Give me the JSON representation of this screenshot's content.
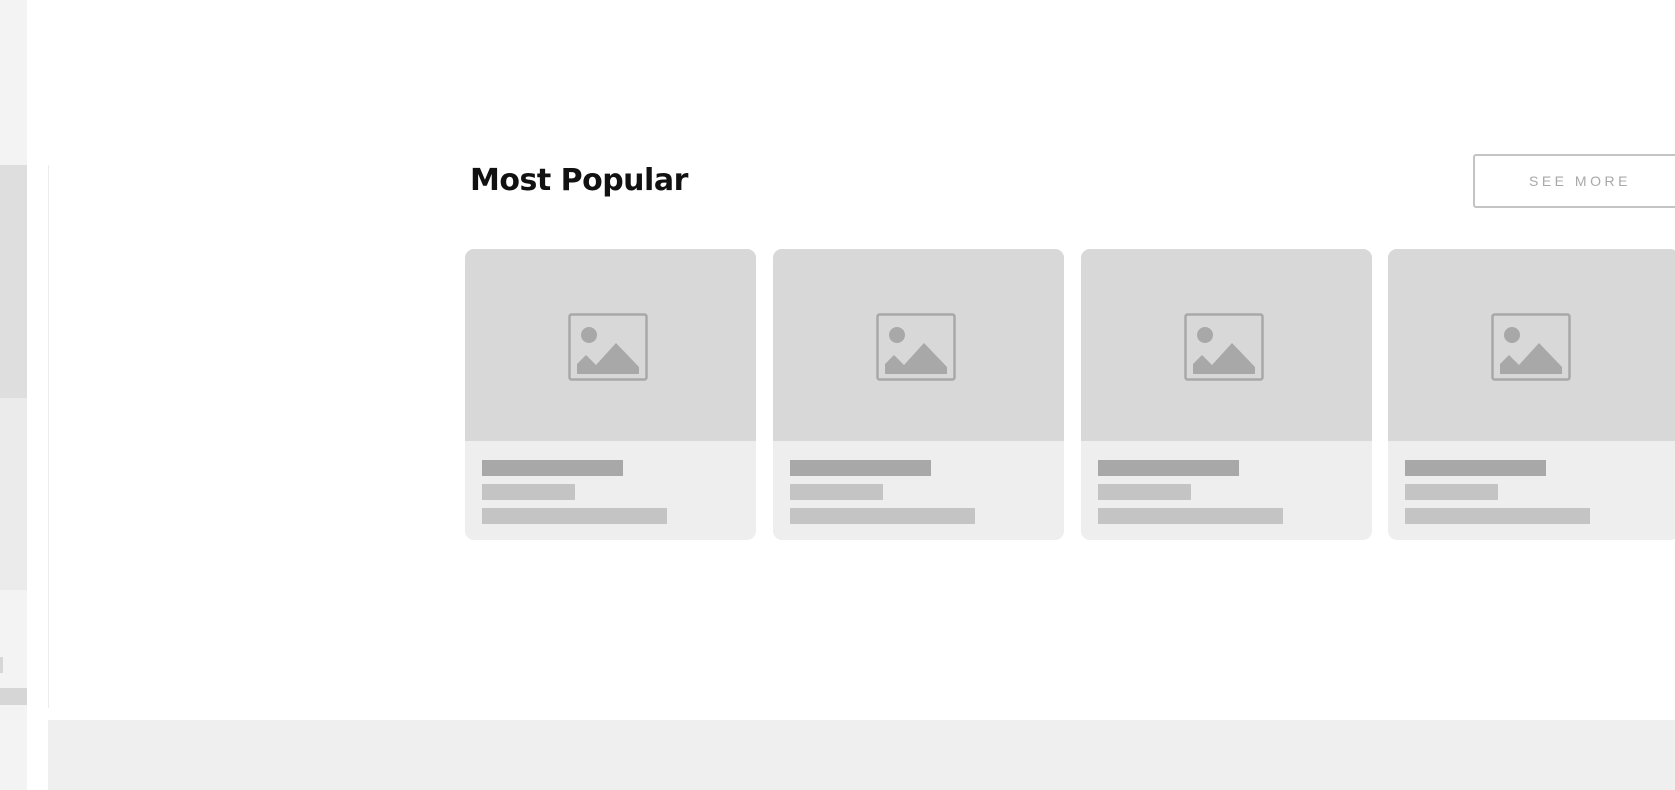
{
  "section": {
    "title": "Most Popular",
    "see_more_label": "SEE MORE"
  },
  "cards": [
    {
      "image": "image-placeholder-icon"
    },
    {
      "image": "image-placeholder-icon"
    },
    {
      "image": "image-placeholder-icon"
    },
    {
      "image": "image-placeholder-icon"
    }
  ],
  "colors": {
    "placeholder_bg": "#d8d8d8",
    "card_bg": "#eeeeee",
    "placeholder_bar_dark": "#a8a8a8",
    "placeholder_bar_light": "#c4c4c4",
    "button_border": "#c4c4c4",
    "title_text": "#111111"
  }
}
